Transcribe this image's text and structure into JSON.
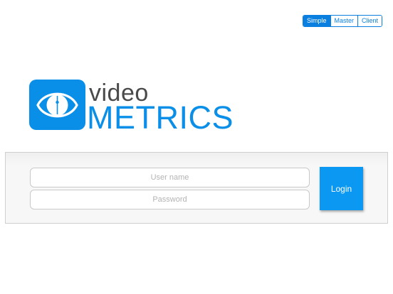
{
  "mode_selector": {
    "options": [
      "Simple",
      "Master",
      "Client"
    ],
    "selected": "Simple"
  },
  "logo": {
    "line1": "video",
    "line2": "METRICS",
    "icon": "eye-icon",
    "colors": {
      "brand_blue": "#0a8fe8",
      "text_gray": "#4a4a4a"
    }
  },
  "login": {
    "username_placeholder": "User name",
    "password_placeholder": "Password",
    "button_label": "Login",
    "button_color": "#0a98f2"
  }
}
